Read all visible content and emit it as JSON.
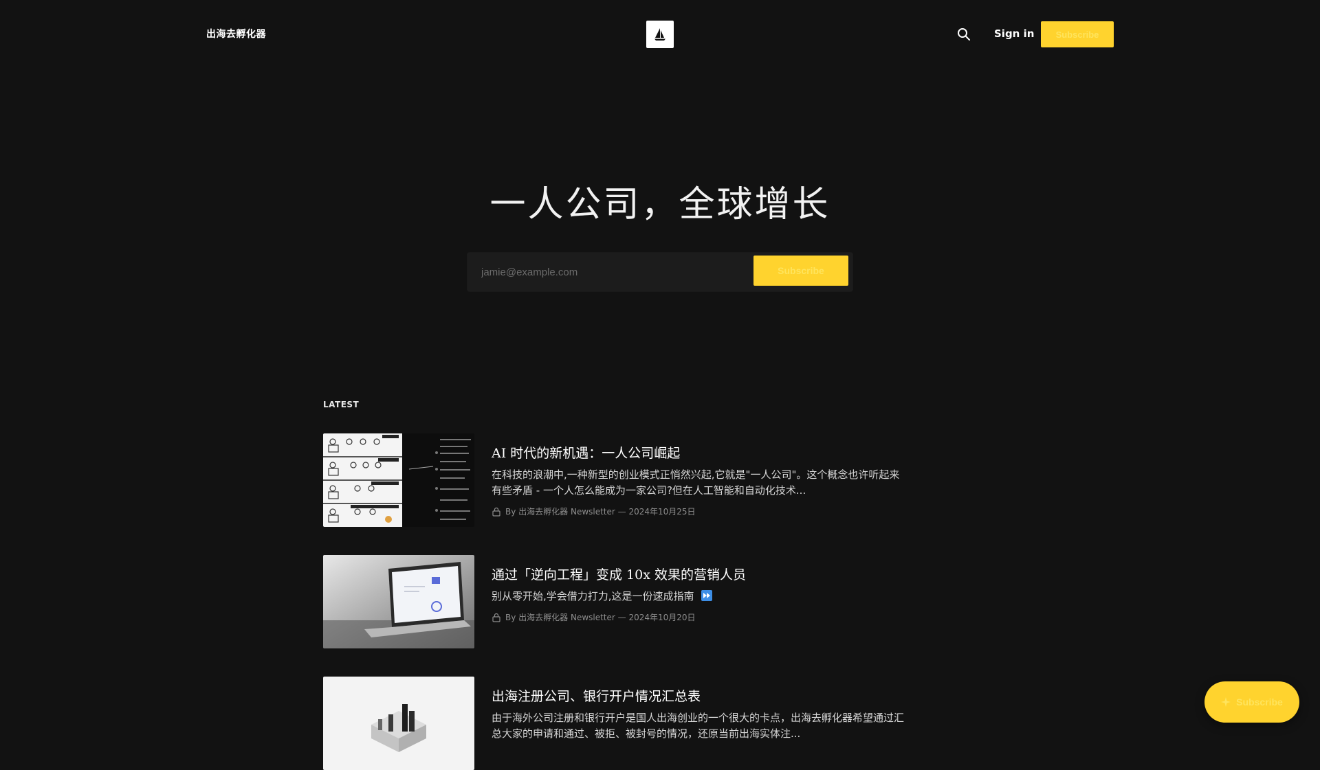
{
  "header": {
    "site_title": "出海去孵化器",
    "logo_icon": "sailboat-icon",
    "search_icon": "search-icon",
    "signin_label": "Sign in",
    "subscribe_label": "Subscribe"
  },
  "hero": {
    "title": "一人公司，全球增长",
    "email_placeholder": "jamie@example.com",
    "subscribe_label": "Subscribe"
  },
  "feed": {
    "section_label": "LATEST",
    "posts": [
      {
        "title": "AI 时代的新机遇：一人公司崛起",
        "excerpt": "在科技的浪潮中,一种新型的创业模式正悄然兴起,它就是\"一人公司\"。这个概念也许听起来有些矛盾 - 一个人怎么能成为一家公司?但在人工智能和自动化技术...",
        "meta": "By 出海去孵化器 Newsletter — 2024年10月25日",
        "thumb_icon": "comic-panel-image"
      },
      {
        "title": "通过「逆向工程」变成 10x 效果的营销人员",
        "excerpt": "别从零开始,学会借力打力,这是一份速成指南",
        "meta": "By 出海去孵化器 Newsletter — 2024年10月20日",
        "thumb_icon": "laptop-image"
      },
      {
        "title": "出海注册公司、银行开户情况汇总表",
        "excerpt": "由于海外公司注册和银行开户是国人出海创业的一个很大的卡点，出海去孵化器希望通过汇总大家的申请和通过、被拒、被封号的情况，还原当前出海实体注...",
        "meta": "",
        "thumb_icon": "isometric-blocks-image"
      }
    ]
  },
  "float_cta": {
    "label": "Subscribe",
    "icon": "sparkle-icon"
  },
  "colors": {
    "background": "#121212",
    "accent": "#FFD32E",
    "text": "#FFFFFF",
    "muted": "#8E8E8E"
  }
}
